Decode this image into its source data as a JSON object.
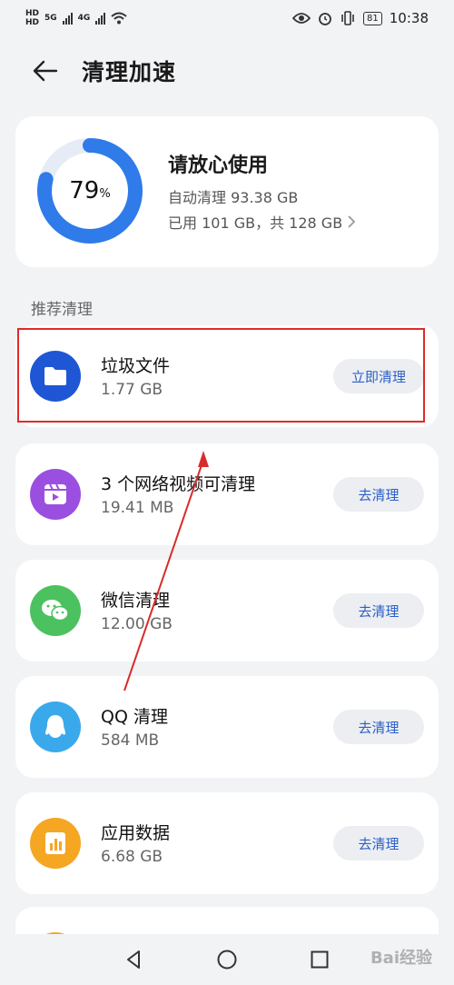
{
  "status_bar": {
    "hd1": "HD",
    "hd2": "HD",
    "net1": "5G",
    "net2": "4G",
    "battery": "81",
    "time": "10:38"
  },
  "header": {
    "title": "清理加速"
  },
  "storage": {
    "percent": "79",
    "percent_unit": "%",
    "percent_value": 79,
    "heading": "请放心使用",
    "auto_clean": "自动清理 93.38 GB",
    "usage": "已用 101 GB，共 128 GB",
    "ring_color": "#2f7be9"
  },
  "section": {
    "label": "推荐清理"
  },
  "items": [
    {
      "name": "垃圾文件",
      "size": "1.77 GB",
      "button": "立即清理",
      "icon": "folder-icon",
      "color": "#1f56d6"
    },
    {
      "name": "3 个网络视频可清理",
      "size": "19.41 MB",
      "button": "去清理",
      "icon": "video-icon",
      "color": "#9b4fe0"
    },
    {
      "name": "微信清理",
      "size": "12.00 GB",
      "button": "去清理",
      "icon": "wechat-icon",
      "color": "#4cc15f"
    },
    {
      "name": "QQ 清理",
      "size": "584 MB",
      "button": "去清理",
      "icon": "qq-icon",
      "color": "#3aa9ec"
    },
    {
      "name": "应用数据",
      "size": "6.68 GB",
      "button": "去清理",
      "icon": "app-data-icon",
      "color": "#f5a623"
    }
  ],
  "watermark": "Bai经验"
}
